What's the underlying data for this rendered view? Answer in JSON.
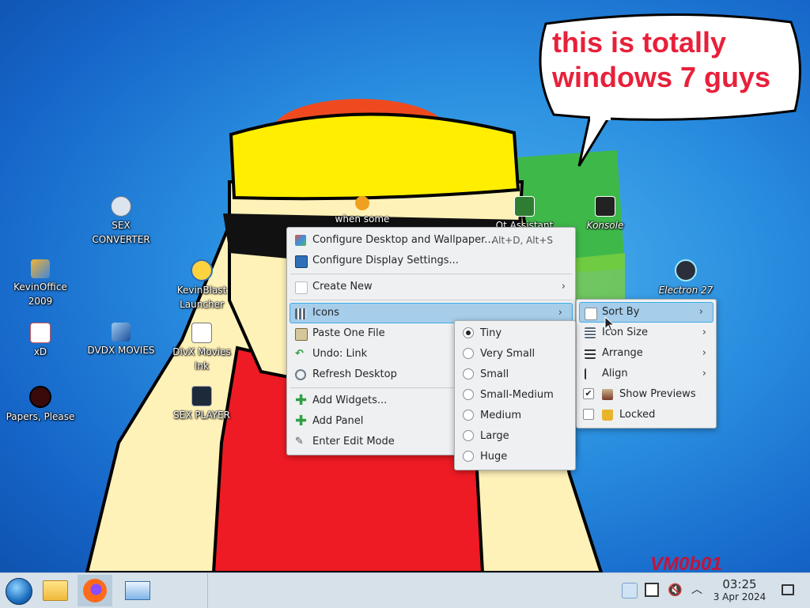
{
  "colors": {
    "accent": "#3daee9",
    "highlight": "#a6cdea",
    "menu_bg": "#eff0f1",
    "taskbar_bg": "#d6e1ea",
    "speech_text": "#e8203a"
  },
  "speech_bubble": {
    "line1": "this is totally",
    "line2": "windows 7 guys"
  },
  "watermark": "VM0b01",
  "desktop_icons": [
    {
      "label": "SEX\nCONVERTER",
      "icon": "converter-icon"
    },
    {
      "label": "KevinOffice\n2009",
      "icon": "office-icon"
    },
    {
      "label": "KevinBlast\nLauncher",
      "icon": "launcher-icon"
    },
    {
      "label": "xD",
      "icon": "xd-icon"
    },
    {
      "label": "DVDX MOVIES",
      "icon": "dvd-icon"
    },
    {
      "label": "DivX Movies\nlnk",
      "icon": "link-icon"
    },
    {
      "label": "Papers, Please",
      "icon": "papers-icon"
    },
    {
      "label": "SEX PLAYER",
      "icon": "terminal-icon"
    },
    {
      "label": "when some",
      "icon": "gear-icon"
    },
    {
      "label": "Qt Assistant",
      "icon": "qt-icon"
    },
    {
      "label": "Konsole",
      "icon": "konsole-icon"
    },
    {
      "label": "Electron 27",
      "icon": "electron-icon"
    }
  ],
  "context_menu": {
    "configure_desktop": {
      "label": "Configure Desktop and Wallpaper...",
      "shortcut": "Alt+D, Alt+S"
    },
    "configure_display": {
      "label": "Configure Display Settings..."
    },
    "create_new": {
      "label": "Create New"
    },
    "icons": {
      "label": "Icons"
    },
    "paste": {
      "label": "Paste One File"
    },
    "undo": {
      "label": "Undo: Link"
    },
    "refresh": {
      "label": "Refresh Desktop"
    },
    "add_widgets": {
      "label": "Add Widgets..."
    },
    "add_panel": {
      "label": "Add Panel"
    },
    "edit_mode": {
      "label": "Enter Edit Mode"
    }
  },
  "icons_submenu": {
    "sort_by": "Sort By",
    "icon_size": "Icon Size",
    "arrange": "Arrange",
    "align": "Align",
    "show_previews": "Show Previews",
    "show_previews_checked": true,
    "locked": "Locked",
    "locked_checked": false
  },
  "size_submenu": {
    "selected": "Tiny",
    "options": [
      "Tiny",
      "Very Small",
      "Small",
      "Small-Medium",
      "Medium",
      "Large",
      "Huge"
    ]
  },
  "taskbar": {
    "clock_time": "03:25",
    "clock_date": "3 Apr 2024"
  }
}
